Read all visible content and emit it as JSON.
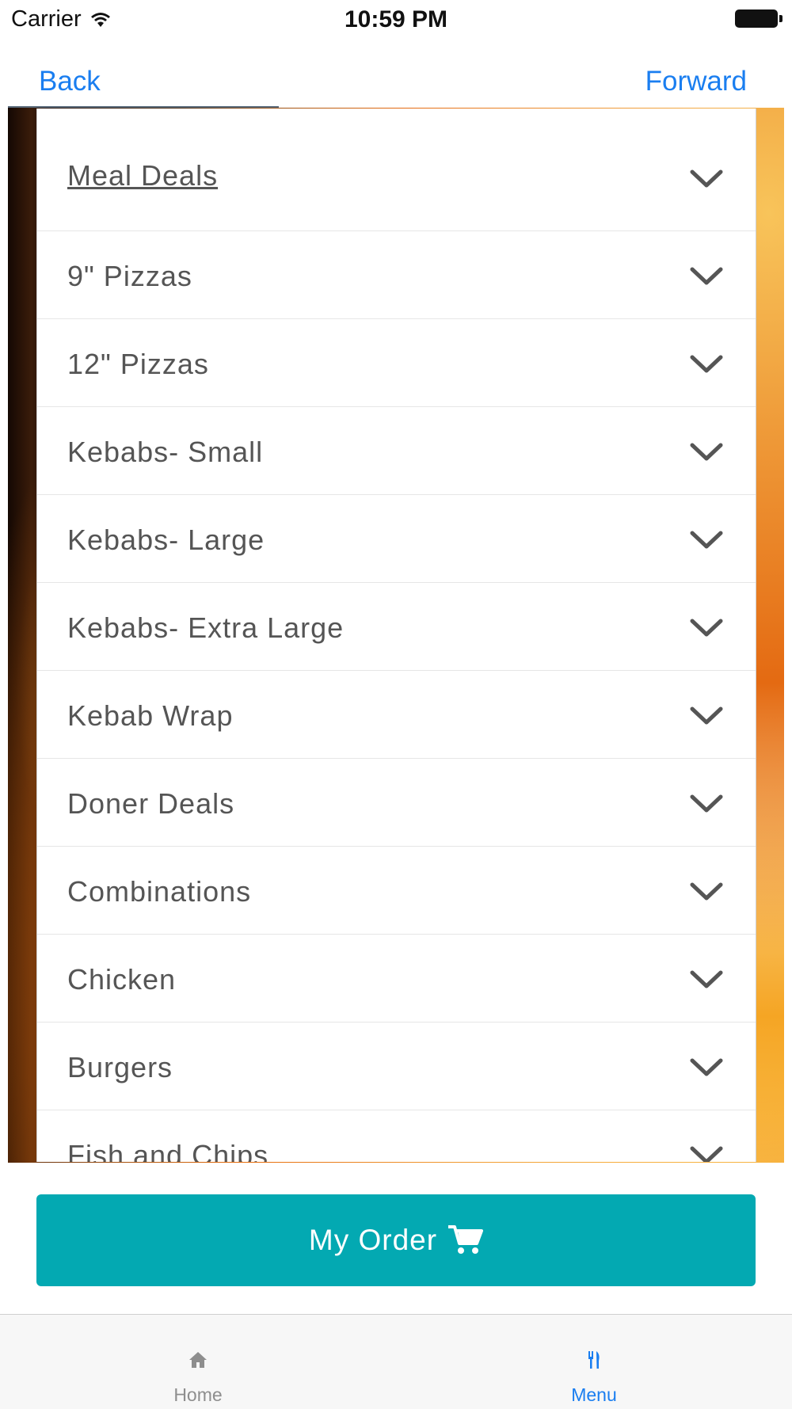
{
  "status_bar": {
    "carrier": "Carrier",
    "time": "10:59 PM"
  },
  "nav": {
    "back_label": "Back",
    "forward_label": "Forward"
  },
  "menu": {
    "items": [
      {
        "label": "Meal Deals"
      },
      {
        "label": "9\" Pizzas"
      },
      {
        "label": "12\" Pizzas"
      },
      {
        "label": "Kebabs- Small"
      },
      {
        "label": "Kebabs- Large"
      },
      {
        "label": "Kebabs- Extra Large"
      },
      {
        "label": "Kebab Wrap"
      },
      {
        "label": "Doner Deals"
      },
      {
        "label": "Combinations"
      },
      {
        "label": "Chicken"
      },
      {
        "label": "Burgers"
      },
      {
        "label": "Fish and Chips"
      }
    ]
  },
  "order_button": {
    "label": "My Order",
    "icon": "cart-icon"
  },
  "tab_bar": {
    "tabs": [
      {
        "label": "Home",
        "icon": "home-icon",
        "active": false
      },
      {
        "label": "Menu",
        "icon": "utensils-icon",
        "active": true
      }
    ]
  },
  "colors": {
    "accent": "#1a7ef0",
    "order_button": "#03a9b2",
    "menu_text": "#555555",
    "tab_inactive": "#8e8e8e"
  }
}
